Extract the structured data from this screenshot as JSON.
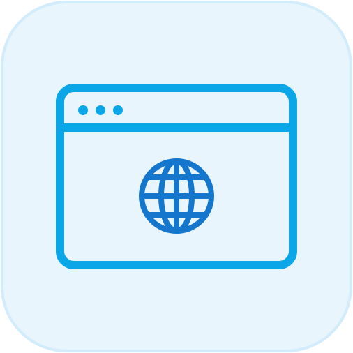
{
  "icon": {
    "name": "browser-window-globe-icon",
    "tile_background": "#e8f5fd",
    "tile_border": "#d3ecfb",
    "window_stroke": "#0aa6e8",
    "globe_stroke": "#1476cc"
  }
}
